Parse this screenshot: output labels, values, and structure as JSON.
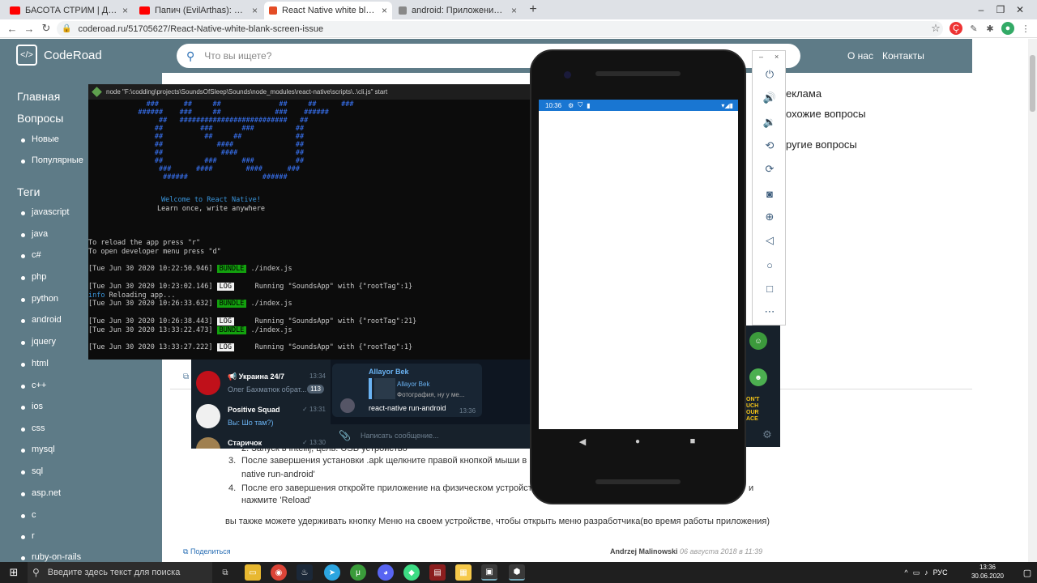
{
  "browser": {
    "tabs": [
      {
        "title": "БАСОТА СТРИМ | ДОНАТ В ОПИ",
        "color": "#ff0000"
      },
      {
        "title": "Папич (EvilArthas): Monkey Busi",
        "color": "#ff0000"
      },
      {
        "title": "React Native white blank screen",
        "color": "#e44d26"
      },
      {
        "title": "android: Приложение React-Na",
        "color": "#555555"
      }
    ],
    "url": "coderoad.ru/51705627/React-Native-white-blank-screen-issue"
  },
  "site": {
    "logo": "CodeRoad",
    "search_placeholder": "Что вы ищете?",
    "links": [
      "О нас",
      "Контакты"
    ],
    "sidebar_sections": [
      {
        "title": "Главная"
      },
      {
        "title": "Вопросы",
        "items": [
          "Новые",
          "Популярные"
        ]
      },
      {
        "title": "Теги",
        "items": [
          "javascript",
          "java",
          "c#",
          "php",
          "python",
          "android",
          "jquery",
          "html",
          "c++",
          "ios",
          "css",
          "mysql",
          "sql",
          "asp.net",
          "c",
          "r",
          "ruby-on-rails"
        ]
      }
    ],
    "right_links": [
      "еклама",
      "охожие вопросы",
      "ругие вопросы"
    ],
    "article": {
      "line_step2": "2. Запуск в intellij, цель: USB устройство",
      "step3_num": "3.",
      "step3": "После завершения установки .apk щелкните правой кнопкой мыши в па",
      "step3b": "native run-android'",
      "step4_num": "4.",
      "step4": "После его завершения откройте приложение на физическом устройстве",
      "step4_end": "и",
      "step4b": "нажмите 'Reload'",
      "paragraph": "вы также можете удерживать кнопку Меню на своем устройстве, чтобы открыть меню разработчика(во время работы приложения)",
      "share": "Поделиться",
      "author": "Andrzej Malinowski",
      "date": "06 августа 2018 в 11:39"
    }
  },
  "terminal": {
    "title": "node  \"F:\\codding\\projects\\SoundsOfSleep\\Sounds\\node_modules\\react-native\\scripts\\..\\cli.js\" start",
    "welcome": "Welcome to React Native!",
    "tagline": "Learn once, write anywhere",
    "reload": "To reload the app press \"r\"",
    "devmenu": "To open developer menu press \"d\"",
    "logs": [
      {
        "time": "[Tue Jun 30 2020 10:22:50.946]",
        "tag": "BUNDLE",
        "msg": " ./index.js"
      },
      {
        "time": "[Tue Jun 30 2020 10:23:02.146]",
        "tag": "LOG",
        "msg": "     Running \"SoundsApp\" with {\"rootTag\":1}"
      },
      {
        "info": "info",
        "text": " Reloading app..."
      },
      {
        "time": "[Tue Jun 30 2020 10:26:33.632]",
        "tag": "BUNDLE",
        "msg": " ./index.js"
      },
      {
        "time": "[Tue Jun 30 2020 10:26:38.443]",
        "tag": "LOG",
        "msg": "     Running \"SoundsApp\" with {\"rootTag\":21}"
      },
      {
        "time": "[Tue Jun 30 2020 13:33:22.473]",
        "tag": "BUNDLE",
        "msg": " ./index.js"
      },
      {
        "time": "[Tue Jun 30 2020 13:33:27.222]",
        "tag": "LOG",
        "msg": "     Running \"SoundsApp\" with {\"rootTag\":1}"
      }
    ]
  },
  "telegram": {
    "chats": [
      {
        "name": "Украина 24/7",
        "message": "Олег Бахматюк обрат...",
        "time": "13:34",
        "badge": "113",
        "color": "#c0101a"
      },
      {
        "name": "Positive Squad",
        "message": "Вы: Шо там?)",
        "time": "✓ 13:31",
        "badge": "",
        "color": "#f0f0f0"
      },
      {
        "name": "Старичок",
        "message": "",
        "time": "✓ 13:30",
        "badge": "",
        "color": "#a08050"
      }
    ],
    "msg_author": "Allayor Bek",
    "msg_quote_author": "Allayor Bek",
    "msg_quote": "Фотография, ну у ме...",
    "msg_text": "react-native run-android",
    "msg_time": "13:36",
    "input_placeholder": "Написать сообщение..."
  },
  "phone": {
    "time": "10:36"
  },
  "emulator_buttons": [
    "power-icon",
    "volume-up-icon",
    "volume-down-icon",
    "rotate-left-icon",
    "rotate-right-icon",
    "camera-icon",
    "zoom-icon",
    "back-icon",
    "home-icon",
    "overview-icon",
    "more-icon"
  ],
  "taskbar": {
    "search_placeholder": "Введите здесь текст для поиска",
    "lang": "РУС",
    "time": "13:36",
    "date": "30.06.2020"
  }
}
